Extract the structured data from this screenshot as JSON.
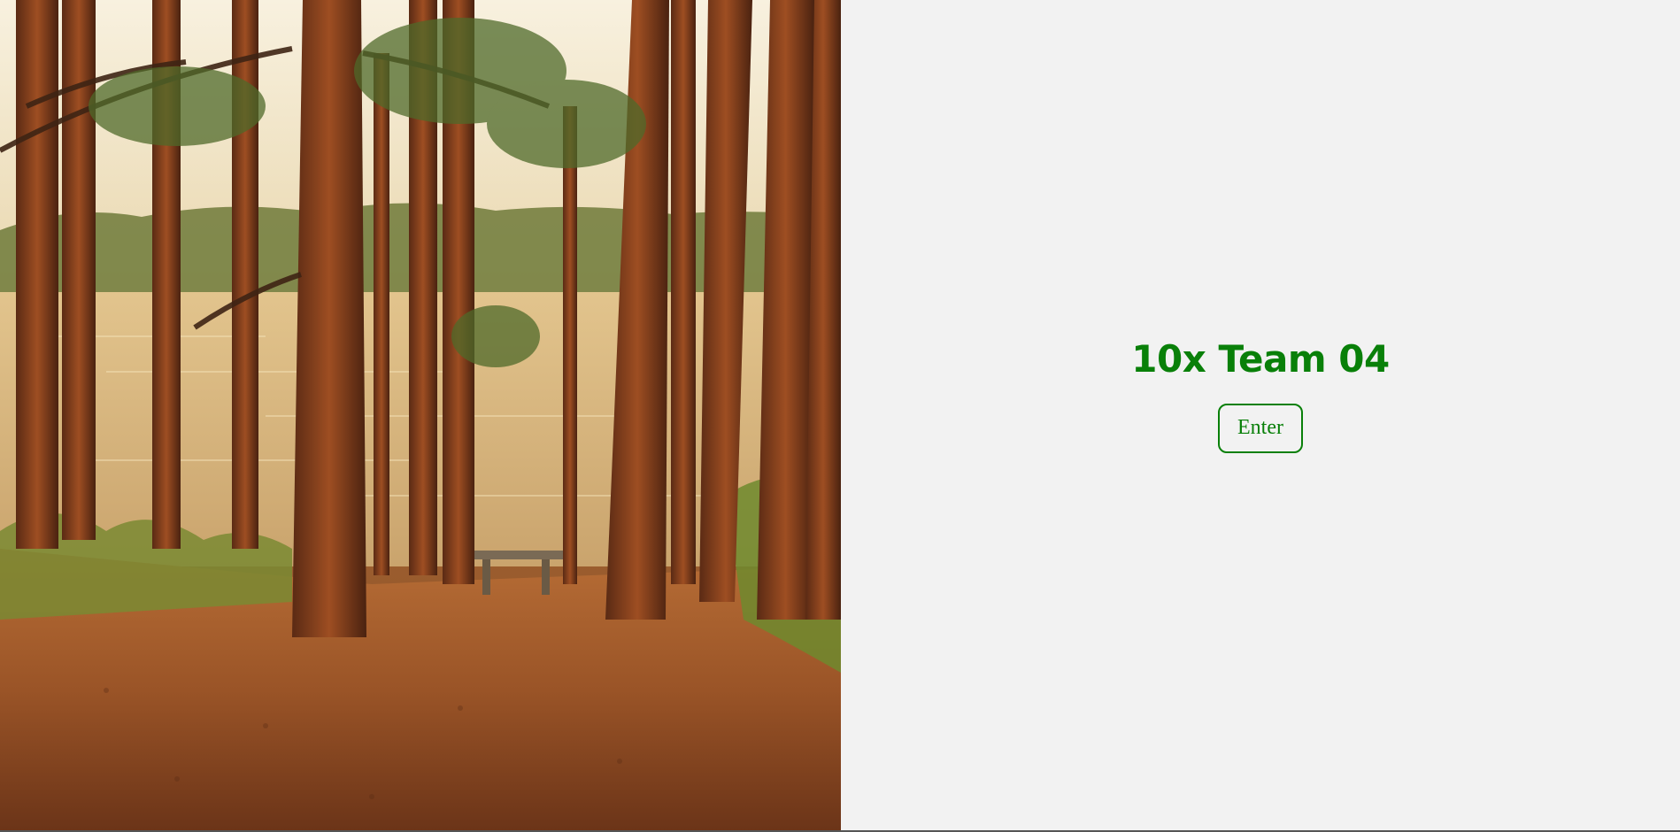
{
  "hero": {
    "image_alt": "Forest path with tall pine trees and a bench overlooking a lake"
  },
  "main": {
    "title": "10x Team 04",
    "enter_label": "Enter"
  },
  "colors": {
    "accent": "#098009",
    "background": "#f2f2f2"
  }
}
